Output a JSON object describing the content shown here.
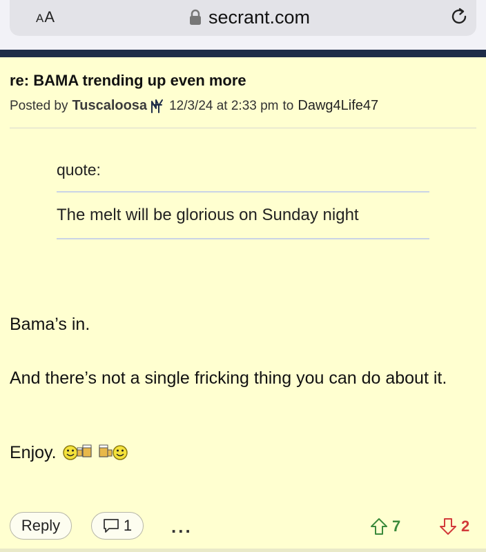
{
  "browser": {
    "text_size_small": "A",
    "text_size_large": "A",
    "url": "secrant.com"
  },
  "post": {
    "title": "re: BAMA trending up even more",
    "posted_by_label": "Posted by",
    "author": "Tuscaloosa",
    "date": "12/3/24 at 2:33 pm",
    "to_label": "to",
    "reply_to": "Dawg4Life47",
    "quote_label": "quote:",
    "quote_text": "The melt will be glorious on Sunday night",
    "paragraphs": [
      "Bama’s in.",
      "And there’s not a single fricking thing you can do about it.",
      "Enjoy."
    ]
  },
  "actions": {
    "reply_label": "Reply",
    "comment_count": "1",
    "more_label": "...",
    "upvotes": "7",
    "downvotes": "2"
  },
  "colors": {
    "page_background": "#ffffd0",
    "navy_band": "#1e2c48",
    "upvote": "#3b8a3b",
    "downvote": "#d23a3a"
  }
}
